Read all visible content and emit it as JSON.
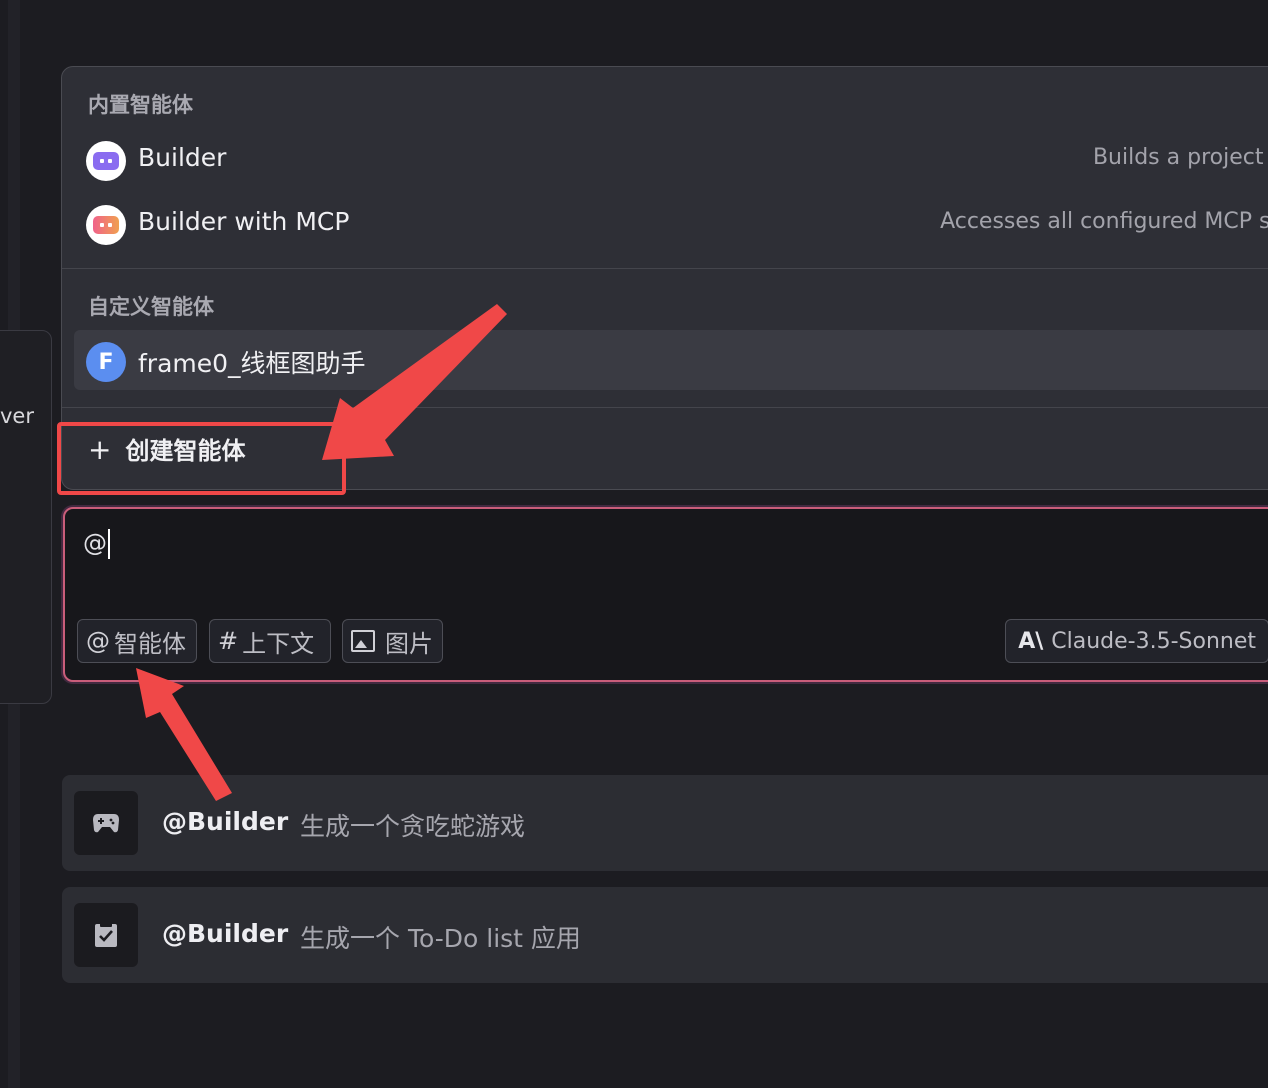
{
  "side_panel": {
    "partial_text": "ver"
  },
  "dropdown": {
    "builtin_section_title": "内置智能体",
    "builtin_agents": [
      {
        "name": "Builder",
        "description": "Builds a project e",
        "avatar_color": "#8a6cf0"
      },
      {
        "name": "Builder with MCP",
        "description": "Accesses all configured MCP se",
        "avatar_color": "#f0628a"
      }
    ],
    "custom_section_title": "自定义智能体",
    "custom_agents": [
      {
        "name": "frame0_线框图助手",
        "avatar_letter": "F",
        "avatar_color": "#5b8ef0"
      }
    ],
    "create_label": "创建智能体",
    "create_icon": "plus-icon"
  },
  "chat_input": {
    "value": "@",
    "chips": [
      {
        "symbol": "@",
        "label": "智能体"
      },
      {
        "symbol": "#",
        "label": "上下文"
      },
      {
        "icon": "image-icon",
        "label": "图片"
      }
    ],
    "model": {
      "logo": "A\\",
      "label": "Claude-3.5-Sonnet"
    }
  },
  "suggestions": [
    {
      "icon": "gamepad-icon",
      "agent": "@Builder",
      "text": "生成一个贪吃蛇游戏"
    },
    {
      "icon": "checklist-icon",
      "agent": "@Builder",
      "text": "生成一个 To-Do list 应用"
    }
  ],
  "annotation_color": "#f04848"
}
